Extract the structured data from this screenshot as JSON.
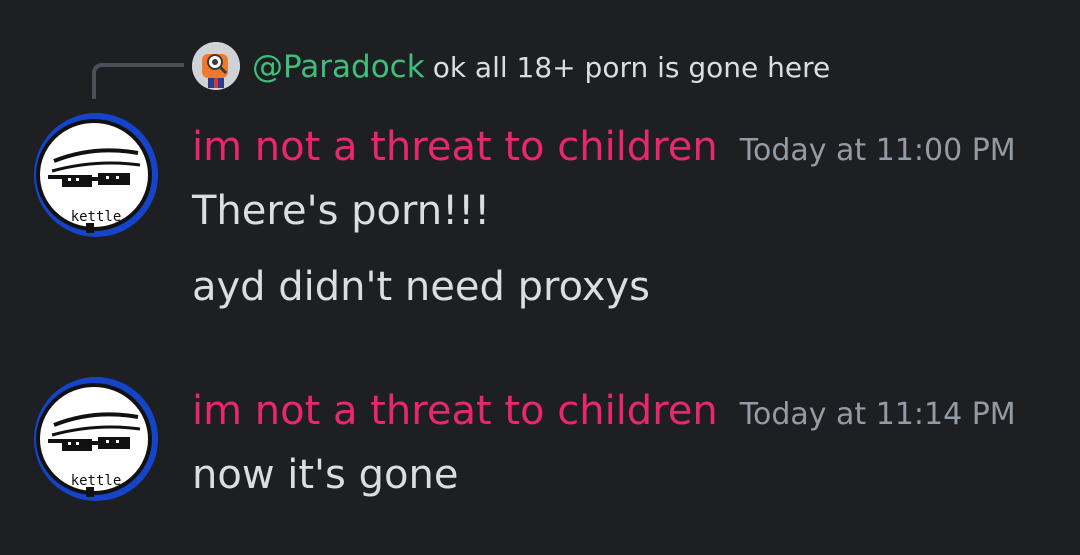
{
  "reply": {
    "author": "@Paradock",
    "text": "ok all 18+ porn is gone here"
  },
  "messages": [
    {
      "author": "im not a threat to children",
      "timestamp": "Today at 11:00 PM",
      "lines": [
        "There's porn!!!",
        "ayd didn't need proxys"
      ],
      "avatar_label": "kettle"
    },
    {
      "author": "im not a threat to children",
      "timestamp": "Today at 11:14 PM",
      "lines": [
        "now it's gone"
      ],
      "avatar_label": "kettle"
    }
  ],
  "colors": {
    "background": "#1e1f22",
    "author_pink": "#e8286b",
    "reply_green": "#3ec07b",
    "timestamp_gray": "#949ba4",
    "message_text": "#dbdee1",
    "avatar_blue": "#1544c9"
  }
}
